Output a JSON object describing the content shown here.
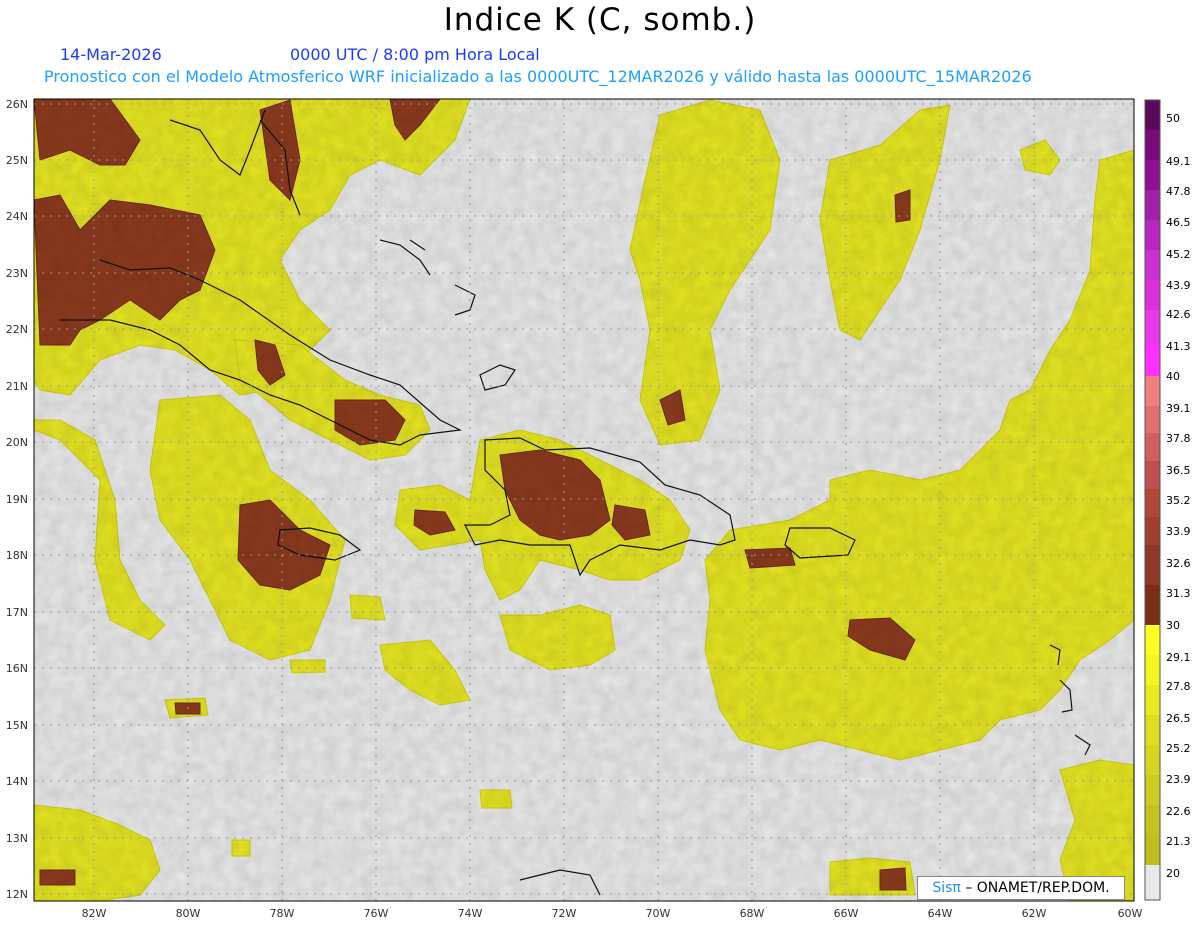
{
  "header": {
    "title": "Indice K (C, somb.)",
    "date": "14-Mar-2026",
    "time": "0000 UTC / 8:00 pm Hora Local",
    "description": "Pronostico con el Modelo Atmosferico WRF inicializado a las 0000UTC_12MAR2026 y válido hasta las  0000UTC_15MAR2026"
  },
  "map": {
    "lon_labels": [
      "82W",
      "80W",
      "78W",
      "76W",
      "74W",
      "72W",
      "70W",
      "68W",
      "66W",
      "64W",
      "62W",
      "60W"
    ],
    "lat_labels": [
      "26N",
      "25N",
      "24N",
      "23N",
      "22N",
      "21N",
      "20N",
      "19N",
      "18N",
      "17N",
      "16N",
      "15N",
      "14N",
      "13N",
      "12N"
    ],
    "grid": true
  },
  "legend": {
    "levels": [
      "50",
      "49.1",
      "47.8",
      "46.5",
      "45.2",
      "43.9",
      "42.6",
      "41.3",
      "40",
      "39.1",
      "37.8",
      "36.5",
      "35.2",
      "33.9",
      "32.6",
      "31.3",
      "30",
      "29.1",
      "27.8",
      "26.5",
      "25.2",
      "23.9",
      "22.6",
      "21.3",
      "20"
    ],
    "colors": {
      "band_20_30": "#eeee22",
      "band_30_40": "#8b3a1e",
      "band_40_50": "#cc22cc",
      "background": "#e8e8e8"
    }
  },
  "credit": {
    "brand": "Sisπ",
    "text": "– ONAMET/REP.DOM."
  }
}
